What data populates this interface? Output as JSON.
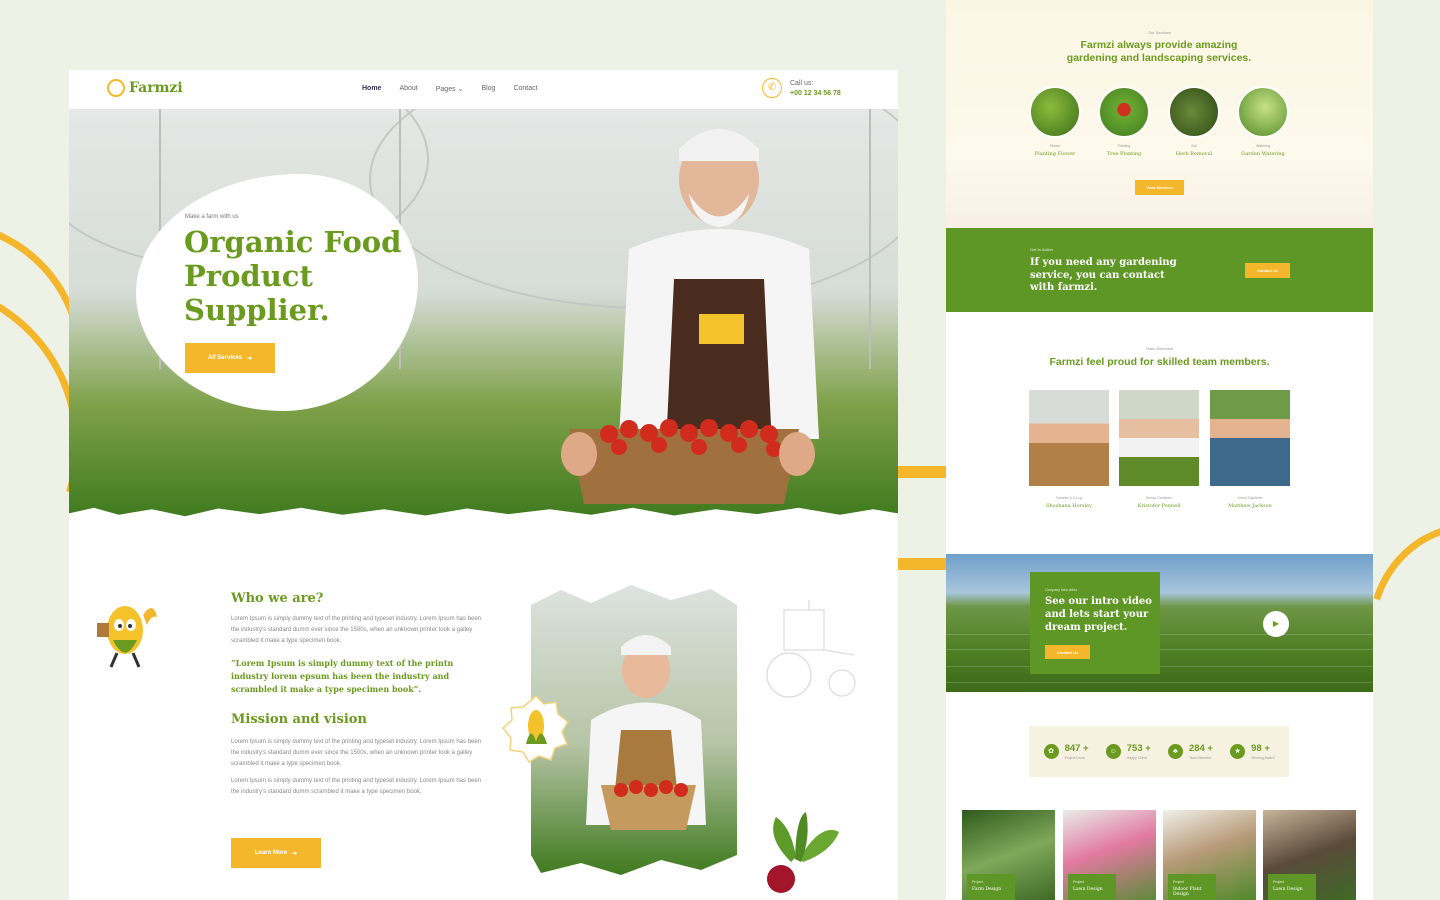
{
  "brand": {
    "name": "Farmzi"
  },
  "nav": {
    "items": [
      "Home",
      "About",
      "Pages",
      "Blog",
      "Contact"
    ],
    "active": "Home",
    "pages_chevron": "⌄"
  },
  "call": {
    "label": "Call us:",
    "phone": "+00 12 34 56 78"
  },
  "hero": {
    "subtitle": "Make a farm with us",
    "title": "Organic Food Product Supplier.",
    "button": "All Services"
  },
  "about": {
    "who_title": "Who we are?",
    "who_text": "Lorem Ipsum is simply dummy text of the printing and typeset industry. Lorem Ipsum has been the industry's standard dumm ever since the 1500s, when an unknown printer took a galley scrambled it make a type specimen book.",
    "quote": "“Lorem Ipsum is simply dummy text of the printn industry lorem epsum has been the industry and scrambled it make a type specimen book”.",
    "mission_title": "Mission and vision",
    "mission_text_1": "Lorem Ipsum is simply dummy text of the printing and typeset industry. Lorem Ipsum has been the industry's standard dumm ever since the 1500s, when an unknown printer took a galley scrambled it make a type specimen book.",
    "mission_text_2": "Lorem Ipsum is simply dummy text of the printing and typeset industry. Lorem Ipsum has been the industry's standard dumm scrambled it make a type specimen book.",
    "button": "Learn More"
  },
  "services": {
    "tag": "Our Services",
    "title": "Farmzi always provide amazing gardening and landscaping services.",
    "items": [
      {
        "category": "Flower",
        "name": "Planting Flower"
      },
      {
        "category": "Planting",
        "name": "Tree Planting"
      },
      {
        "category": "Soil",
        "name": "Herb Removal"
      },
      {
        "category": "Watering",
        "name": "Garden Watering"
      }
    ],
    "button": "View Services"
  },
  "contact_banner": {
    "tag": "Get In Action",
    "text": "If you need any gardening service, you can contact with farmzi.",
    "button": "Contact Us"
  },
  "team": {
    "tag": "Team Members",
    "title": "Farmzi feel proud for skilled team members.",
    "members": [
      {
        "role": "Founder & Co-op",
        "name": "Shoshana Horsley"
      },
      {
        "role": "Senior Gardener",
        "name": "Kristofer Pennell"
      },
      {
        "role": "Junior Gardener",
        "name": "Matthew Jackson"
      }
    ]
  },
  "video": {
    "tag": "Company intro video",
    "text": "See our intro video and lets start your dream project.",
    "button": "Contact Us",
    "play_icon": "▶"
  },
  "stats": [
    {
      "value": "847 +",
      "label": "Project Done"
    },
    {
      "value": "753 +",
      "label": "Happy Client"
    },
    {
      "value": "284 +",
      "label": "Team Member"
    },
    {
      "value": "98 +",
      "label": "Winning Award"
    }
  ],
  "projects": [
    {
      "category": "Project",
      "name": "Farm Design"
    },
    {
      "category": "Project",
      "name": "Lawn Design"
    },
    {
      "category": "Project",
      "name": "Indoor Plant Design"
    },
    {
      "category": "Project",
      "name": "Lawn Design"
    }
  ],
  "colors": {
    "accent_green": "#6a9a1e",
    "accent_yellow": "#f4b72c",
    "banner_green": "#5f9726"
  }
}
